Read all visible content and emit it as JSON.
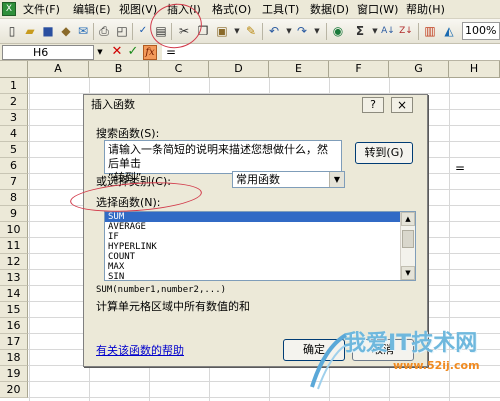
{
  "menu": {
    "items": [
      "文件(F)",
      "编辑(E)",
      "视图(V)",
      "插入(I)",
      "格式(O)",
      "工具(T)",
      "数据(D)",
      "窗口(W)",
      "帮助(H)"
    ]
  },
  "toolbar": {
    "zoom": "100%",
    "icons": [
      "new-icon",
      "open-icon",
      "save-icon",
      "permission-icon",
      "email-icon",
      "print-icon",
      "print-preview-icon",
      "spelling-icon",
      "research-icon",
      "cut-icon",
      "copy-icon",
      "paste-icon",
      "format-painter-icon",
      "undo-icon",
      "redo-icon",
      "hyperlink-icon",
      "autosum-icon",
      "sort-asc-icon",
      "sort-desc-icon",
      "chart-wizard-icon",
      "drawing-icon"
    ]
  },
  "formula_bar": {
    "name_box": "H6",
    "content": "="
  },
  "sheet": {
    "columns": [
      "A",
      "B",
      "C",
      "D",
      "E",
      "F",
      "G",
      "H"
    ],
    "rows": [
      "1",
      "2",
      "3",
      "4",
      "5",
      "6",
      "7",
      "8",
      "9",
      "10",
      "11",
      "12",
      "13",
      "14",
      "15",
      "16",
      "17",
      "18",
      "19",
      "20"
    ],
    "cell_h6": "="
  },
  "dialog": {
    "title": "插入函数",
    "help_button": "?",
    "close_button": "×",
    "search_label": "搜索函数(S):",
    "search_text_line1": "请输入一条简短的说明来描述您想做什么，然后单击",
    "search_text_line2": "“转到”",
    "goto_button": "转到(G)",
    "category_label": "或选择类别(C):",
    "category_value": "常用函数",
    "function_label": "选择函数(N):",
    "functions": [
      "SUM",
      "AVERAGE",
      "IF",
      "HYPERLINK",
      "COUNT",
      "MAX",
      "SIN"
    ],
    "selected_function": "SUM",
    "signature": "SUM(number1,number2,...)",
    "description": "计算单元格区域中所有数值的和",
    "help_link": "有关该函数的帮助",
    "ok_button": "确定",
    "cancel_button": "取消"
  },
  "watermark": {
    "text": "我爱IT技术网",
    "url": "www.52ij.com"
  }
}
